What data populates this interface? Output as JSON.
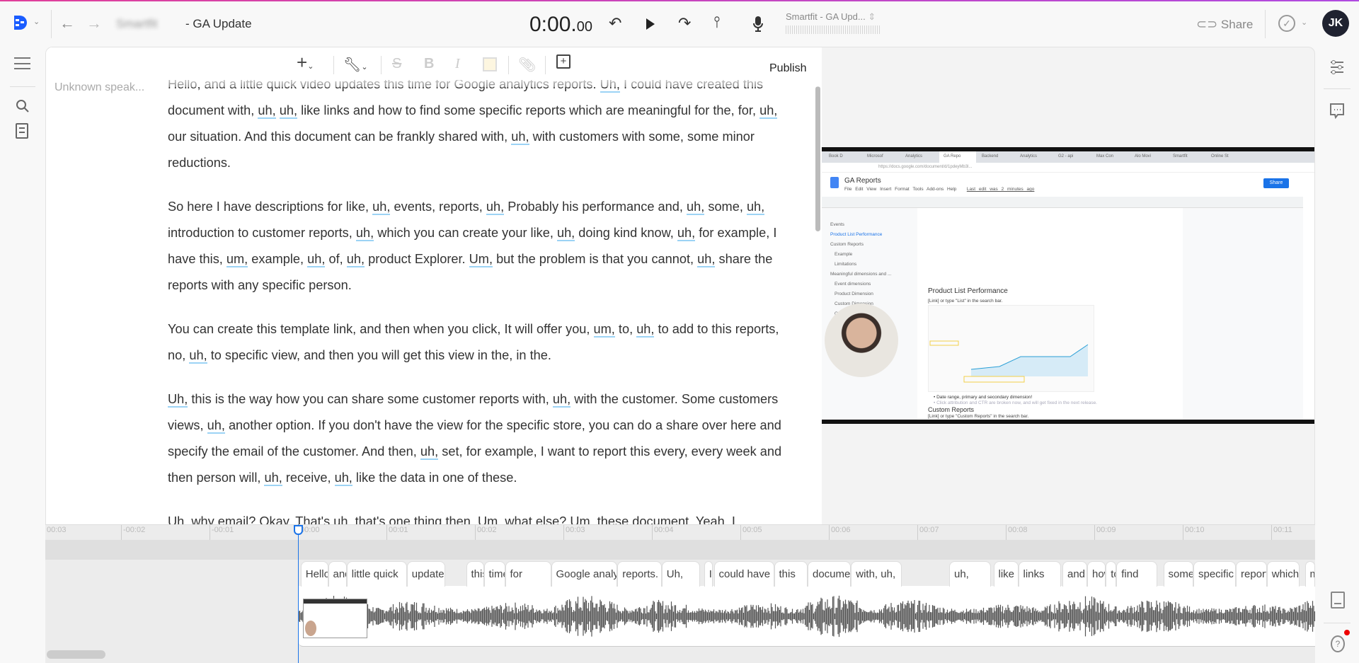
{
  "header": {
    "project_prefix": "Smartfit",
    "title": "- GA Update",
    "time_main": "0:00.",
    "time_frac": "00",
    "project_selector": "Smartfit - GA Upd...",
    "share_label": "Share",
    "avatar_initials": "JK"
  },
  "icons": {
    "logo": "descript-logo",
    "back": "arrow-left-icon",
    "forward": "arrow-right-icon",
    "undo": "rewind-icon",
    "play": "play-icon",
    "redo": "forward-icon",
    "split": "split-icon",
    "mic": "mic-icon",
    "link": "link-icon",
    "check": "check-circle-icon"
  },
  "toolbar": {
    "publish_label": "Publish"
  },
  "editor": {
    "speaker": "Unknown speak...",
    "paragraphs": [
      [
        [
          "Hello, and a little quick video updates this time for Google analytics reports. "
        ],
        [
          "Uh,",
          1
        ],
        [
          " I could have created this document with, "
        ],
        [
          "uh,",
          1
        ],
        [
          " "
        ],
        [
          "uh,",
          1
        ],
        [
          " like links and how to find some specific reports which are meaningful for the, for, "
        ],
        [
          "uh,",
          1
        ],
        [
          " our situation. And this document can be frankly shared with, "
        ],
        [
          "uh,",
          1
        ],
        [
          " with customers with some, some minor reductions."
        ]
      ],
      [
        [
          "So here I have descriptions for like, "
        ],
        [
          "uh,",
          1
        ],
        [
          " events, reports, "
        ],
        [
          "uh,",
          1
        ],
        [
          " Probably his performance and, "
        ],
        [
          "uh,",
          1
        ],
        [
          " some, "
        ],
        [
          "uh,",
          1
        ],
        [
          " introduction to customer reports, "
        ],
        [
          "uh,",
          1
        ],
        [
          " which you can create your like, "
        ],
        [
          "uh,",
          1
        ],
        [
          " doing kind know, "
        ],
        [
          "uh,",
          1
        ],
        [
          " for example, I have this, "
        ],
        [
          "um,",
          1
        ],
        [
          " example, "
        ],
        [
          "uh,",
          1
        ],
        [
          " of, "
        ],
        [
          "uh,",
          1
        ],
        [
          " product Explorer. "
        ],
        [
          "Um,",
          1
        ],
        [
          " but the problem is that you cannot, "
        ],
        [
          "uh,",
          1
        ],
        [
          " share the reports with any specific person."
        ]
      ],
      [
        [
          "You can create this template link, and then when you click, It will offer you, "
        ],
        [
          "um,",
          1
        ],
        [
          " to, "
        ],
        [
          "uh,",
          1
        ],
        [
          " to add to this reports, no, "
        ],
        [
          "uh,",
          1
        ],
        [
          " to specific view, and then you will get this view in the, in the."
        ]
      ],
      [
        [
          "Uh,",
          1
        ],
        [
          " this is the way how you can share some customer reports with, "
        ],
        [
          "uh,",
          1
        ],
        [
          " with the customer. Some customers views, "
        ],
        [
          "uh,",
          1
        ],
        [
          " another option. If you don't have the view for the specific store, you can do a share over here and specify the email of the customer. And then, "
        ],
        [
          "uh,",
          1
        ],
        [
          " set, for example, I want to report this every, every week and then person will, "
        ],
        [
          "uh,",
          1
        ],
        [
          " receive, "
        ],
        [
          "uh,",
          1
        ],
        [
          " like the data in one of these."
        ]
      ],
      [
        [
          "Uh, why email? Okay. That's uh, that's one thing then. Um, what else? Um, these document. Yeah, I"
        ]
      ]
    ]
  },
  "video": {
    "tabs": [
      "Book D",
      "Microsof",
      "Analytics",
      "GA Repo",
      "Backend",
      "Analytics",
      "G2 - api",
      "Max Con",
      "Alo Movi",
      "Smartfit",
      "Online St"
    ],
    "url": "https://docs.google.com/document/d/1pdeyMb3l...",
    "doc_title": "GA Reports",
    "menu": "File Edit View Insert Format Tools Add-ons Help",
    "last_edit": "Last edit was 2 minutes ago",
    "share": "Share",
    "outline": [
      "Events",
      "Product List Performance",
      "Custom Reports",
      "Example",
      "Limitations",
      "Meaningful dimensions and ...",
      "Event dimensions",
      "Product Dimension",
      "Custom Dimension",
      "Other Dimension"
    ],
    "heading1": "Product List Performance",
    "line1": "[Link] or type \"List\" in the search bar.",
    "bullet1": "Date range, primary and secondary dimension!",
    "bullet2": "Click attribution and CTR are broken now, and will get fixed in the next release.",
    "heading2": "Custom Reports",
    "line2": "[Link] or type \"Custom Reports\" in the search bar."
  },
  "timeline": {
    "ticks": [
      "00:03",
      "-00:02",
      "-00:01",
      "00:00",
      "00:01",
      "00:02",
      "00:03",
      "00:04",
      "00:05",
      "00:06",
      "00:07",
      "00:08",
      "00:09",
      "00:10",
      "00:11"
    ],
    "tick_seconds": [
      -3,
      -2,
      -1,
      0,
      1,
      2,
      3,
      4,
      5,
      6,
      7,
      8,
      9,
      10,
      11
    ],
    "playhead_seconds": 0,
    "words": [
      {
        "w": "Hello,",
        "s": 0.03,
        "e": 0.34
      },
      {
        "w": "and",
        "s": 0.34,
        "e": 0.55
      },
      {
        "w": "little quick",
        "s": 0.55,
        "e": 1.23
      },
      {
        "w": "update",
        "s": 1.23,
        "e": 1.66
      },
      {
        "w": "this",
        "s": 1.9,
        "e": 2.1
      },
      {
        "w": "time",
        "s": 2.1,
        "e": 2.34
      },
      {
        "w": "for",
        "s": 2.34,
        "e": 2.86
      },
      {
        "w": "Google analytics",
        "s": 2.86,
        "e": 3.61
      },
      {
        "w": "reports.",
        "s": 3.61,
        "e": 4.11
      },
      {
        "w": "Uh,",
        "s": 4.11,
        "e": 4.54
      },
      {
        "w": "I",
        "s": 4.59,
        "e": 4.69
      },
      {
        "w": "could have",
        "s": 4.7,
        "e": 5.38
      },
      {
        "w": "this",
        "s": 5.38,
        "e": 5.76
      },
      {
        "w": "document",
        "s": 5.76,
        "e": 6.25
      },
      {
        "w": "with, uh,",
        "s": 6.25,
        "e": 6.82
      },
      {
        "w": "uh,",
        "s": 7.36,
        "e": 7.83
      },
      {
        "w": "like",
        "s": 7.86,
        "e": 8.14
      },
      {
        "w": "links",
        "s": 8.14,
        "e": 8.62
      },
      {
        "w": "and",
        "s": 8.64,
        "e": 8.92
      },
      {
        "w": "how",
        "s": 8.92,
        "e": 9.13
      },
      {
        "w": "to",
        "s": 9.13,
        "e": 9.25
      },
      {
        "w": "find",
        "s": 9.25,
        "e": 9.71
      },
      {
        "w": "some",
        "s": 9.78,
        "e": 10.12
      },
      {
        "w": "specific",
        "s": 10.12,
        "e": 10.6
      },
      {
        "w": "reports",
        "s": 10.6,
        "e": 10.95
      },
      {
        "w": "which",
        "s": 10.95,
        "e": 11.32
      },
      {
        "w": "meaningful",
        "s": 11.38,
        "e": 12
      }
    ]
  },
  "sidebar": {
    "left": [
      "menu-icon",
      "search-icon",
      "notebook-icon"
    ],
    "right": [
      "sliders-icon",
      "comment-icon",
      "panel-icon",
      "help-icon"
    ]
  },
  "colors": {
    "accent": "#1a73e8",
    "filler_underline": "#9cd3f5",
    "avatar_bg": "#1f2230",
    "notification": "#ee0000"
  }
}
